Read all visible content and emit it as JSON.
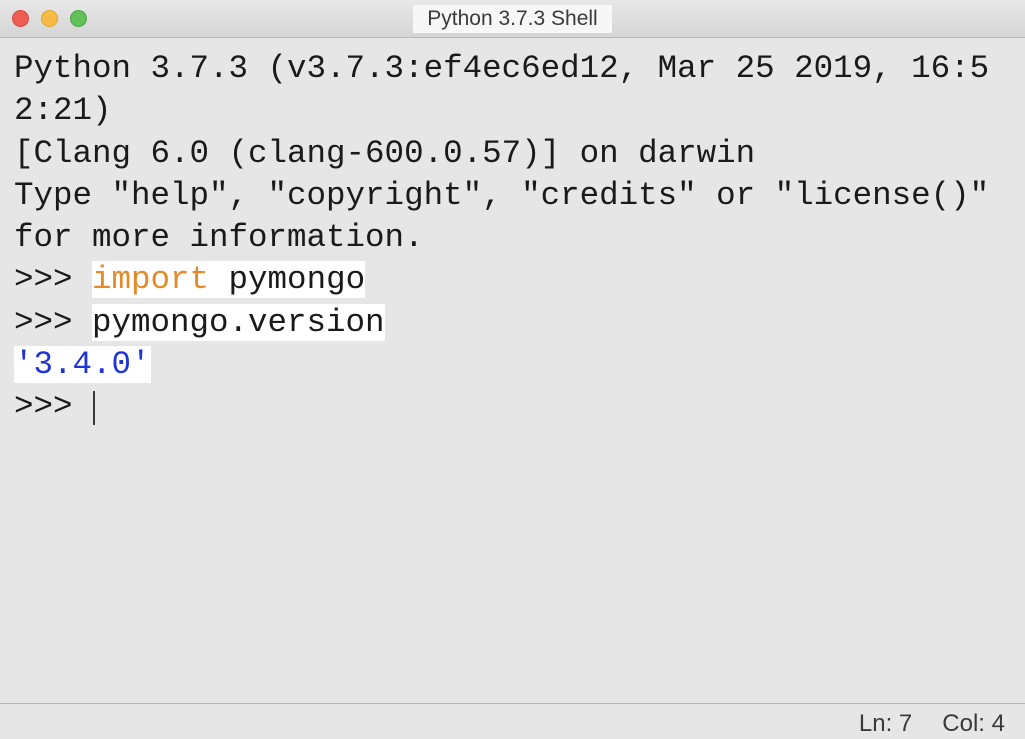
{
  "window": {
    "title": "Python 3.7.3 Shell"
  },
  "shell": {
    "banner_line1": "Python 3.7.3 (v3.7.3:ef4ec6ed12, Mar 25 2019, 16:52:21)",
    "banner_line2": "[Clang 6.0 (clang-600.0.57)] on darwin",
    "banner_line3": "Type \"help\", \"copyright\", \"credits\" or \"license()\" for more information.",
    "prompt": ">>> ",
    "input1_kw": "import",
    "input1_rest": " pymongo",
    "input2": "pymongo.version",
    "output1": "'3.4.0'"
  },
  "status": {
    "ln_label": "Ln: ",
    "ln_value": "7",
    "col_label": "Col: ",
    "col_value": "4"
  }
}
